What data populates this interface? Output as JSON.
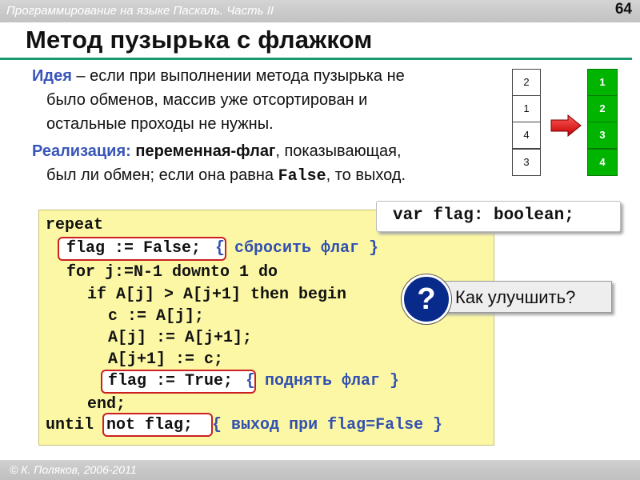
{
  "header": {
    "course": "Программирование на языке Паскаль. Часть II",
    "page_number": "64"
  },
  "title": "Метод пузырька с флажком",
  "idea": {
    "label": "Идея",
    "line1": " – если при выполнении метода пузырька не",
    "line2": "было обменов, массив уже отсортирован и",
    "line3": "остальные проходы не нужны."
  },
  "impl": {
    "label": "Реализация:",
    "bold": " переменная-флаг",
    "rest1": ", показывающая,",
    "line2a": "был ли обмен; если она равна ",
    "line2b": "False",
    "line2c": ", то выход."
  },
  "array_before": [
    "2",
    "1",
    "4",
    "3"
  ],
  "array_after": [
    "1",
    "2",
    "3",
    "4"
  ],
  "code": {
    "l1": "repeat",
    "l2_code": "flag := False;",
    "l2_cmt": "{ сбросить флаг }",
    "l3": "for j:=N-1 downto 1 do",
    "l4": "if A[j] > A[j+1] then begin",
    "l5": "c := A[j];",
    "l6": "A[j] := A[j+1];",
    "l7": "A[j+1] := c;",
    "l8_code": "flag := True;",
    "l8_cmt": "{ поднять флаг }",
    "l9": "end;",
    "l10_kw": "until",
    "l10_code": "not flag;",
    "l10_cmt": "{ выход при flag=False }"
  },
  "var_decl": "var flag: boolean;",
  "question": {
    "symbol": "?",
    "text": "Как улучшить?"
  },
  "footer": "© К. Поляков, 2006-2011",
  "colors": {
    "accent": "#1c9a6e",
    "keyword_blue": "#3856b8",
    "code_bg": "#fbf7a4",
    "sorted_green": "#00b400",
    "highlight_red": "#cc2020"
  }
}
